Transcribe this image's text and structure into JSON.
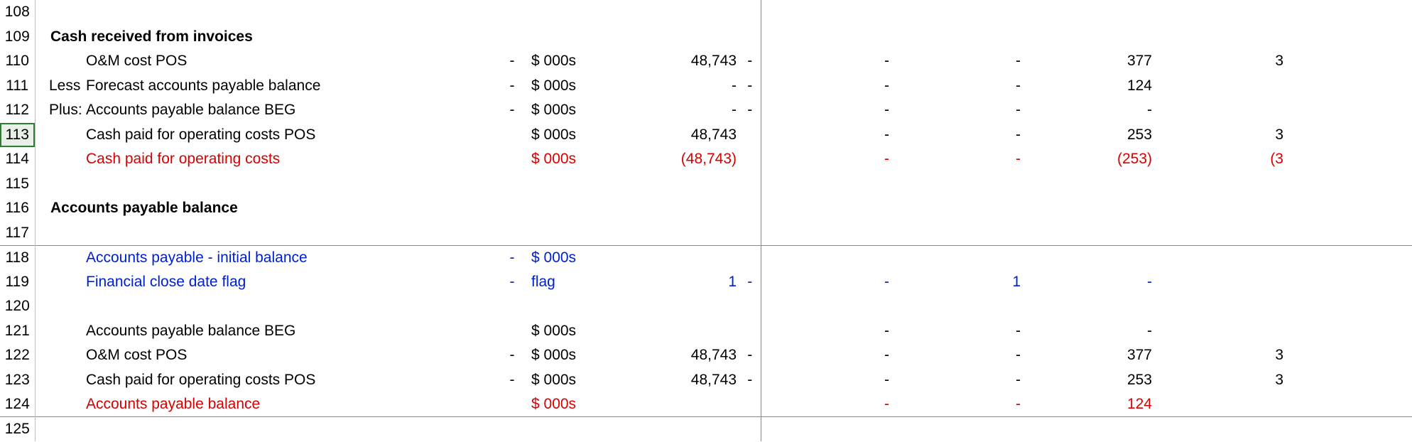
{
  "rows": [
    {
      "num": "108"
    },
    {
      "num": "109",
      "header": "Cash received from invoices"
    },
    {
      "num": "110",
      "label": "O&M cost POS",
      "dash": "-",
      "unit": "$ 000s",
      "g": "48,743",
      "h": "-",
      "i": "-",
      "j": "-",
      "k": "377",
      "l": "3"
    },
    {
      "num": "111",
      "prefix": "Less:",
      "label": "Forecast accounts payable balance",
      "dash": "-",
      "unit": "$ 000s",
      "g": "-",
      "h": "-",
      "i": "-",
      "j": "-",
      "k": "124"
    },
    {
      "num": "112",
      "prefix": "Plus:",
      "label": "Accounts payable balance BEG",
      "dash": "-",
      "unit": "$ 000s",
      "g": "-",
      "h": "-",
      "i": "-",
      "j": "-",
      "k": "-"
    },
    {
      "num": "113",
      "selected": true,
      "label": "Cash paid for operating costs POS",
      "unit": "$ 000s",
      "g": "48,743",
      "i": "-",
      "j": "-",
      "k": "253",
      "l": "3"
    },
    {
      "num": "114",
      "color": "red",
      "label": "Cash paid for operating costs",
      "unit": "$ 000s",
      "g": "(48,743)",
      "i": "-",
      "j": "-",
      "k": "(253)",
      "l": "(3"
    },
    {
      "num": "115"
    },
    {
      "num": "116",
      "header": "Accounts payable balance"
    },
    {
      "num": "117"
    },
    {
      "num": "118",
      "color": "blue",
      "sep": true,
      "label": "Accounts payable - initial balance",
      "dash": "-",
      "unit": "$ 000s"
    },
    {
      "num": "119",
      "color": "blue",
      "label": "Financial close date flag",
      "dash": "-",
      "unit": "flag",
      "g": "1",
      "h": "-",
      "i": "-",
      "j": "1",
      "k": "-"
    },
    {
      "num": "120"
    },
    {
      "num": "121",
      "label": "Accounts payable balance BEG",
      "unit": "$ 000s",
      "i": "-",
      "j": "-",
      "k": "-"
    },
    {
      "num": "122",
      "label": "O&M cost POS",
      "dash": "-",
      "unit": "$ 000s",
      "g": "48,743",
      "h": "-",
      "i": "-",
      "j": "-",
      "k": "377",
      "l": "3"
    },
    {
      "num": "123",
      "label": "Cash paid for operating costs POS",
      "dash": "-",
      "unit": "$ 000s",
      "g": "48,743",
      "h": "-",
      "i": "-",
      "j": "-",
      "k": "253",
      "l": "3"
    },
    {
      "num": "124",
      "color": "red",
      "label": "Accounts payable balance",
      "unit": "$ 000s",
      "i": "-",
      "j": "-",
      "k": "124"
    },
    {
      "num": "125",
      "sep": true
    }
  ]
}
